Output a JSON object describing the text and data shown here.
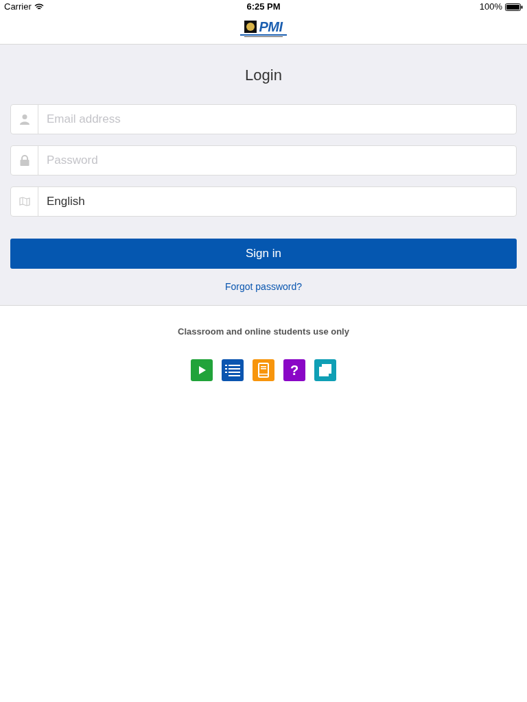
{
  "status_bar": {
    "carrier": "Carrier",
    "time": "6:25 PM",
    "battery": "100%"
  },
  "header": {
    "logo_text": "PMI"
  },
  "login": {
    "title": "Login",
    "fields": [
      {
        "kind": "email",
        "placeholder": "Email address"
      },
      {
        "kind": "password",
        "placeholder": "Password"
      },
      {
        "kind": "language",
        "value": "English"
      }
    ],
    "submit": "Sign in",
    "forgot": "Forgot password?"
  },
  "footer": {
    "note": "Classroom and online students use only",
    "apps": [
      {
        "kind": "play",
        "color": "#21a33a"
      },
      {
        "kind": "list",
        "color": "#0b55b0"
      },
      {
        "kind": "book",
        "color": "#f7950c"
      },
      {
        "kind": "help",
        "color": "#8a07c6",
        "glyph": "?"
      },
      {
        "kind": "windows",
        "color": "#0f9fb5"
      }
    ]
  }
}
